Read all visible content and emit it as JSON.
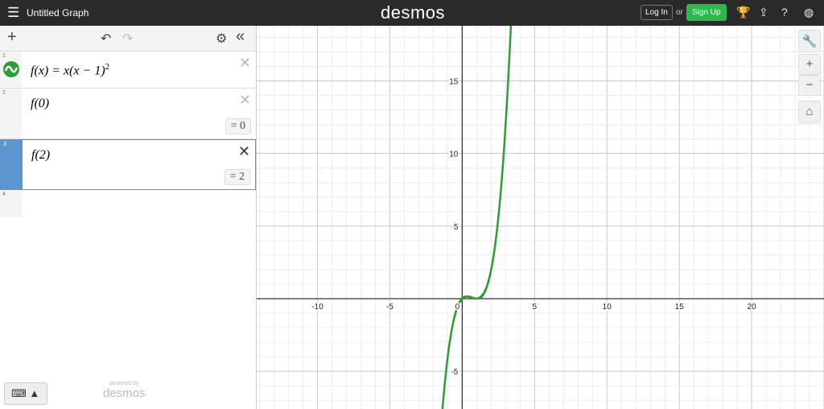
{
  "header": {
    "menu_icon": "hamburger-icon",
    "title": "Untitled Graph",
    "logo": "desmos",
    "login": "Log In",
    "or": "or",
    "signup": "Sign Up",
    "signup_color": "#2db84b",
    "icons": [
      "trophy-icon",
      "share-icon",
      "help-icon",
      "globe-icon"
    ]
  },
  "toolbar": {
    "add": "+",
    "undo": "↶",
    "redo": "↷",
    "settings": "⚙",
    "collapse": "«"
  },
  "expressions": [
    {
      "index": "1",
      "latex": "f(x) = x(x − 1)",
      "sup": "2",
      "color": "#2f9c3a"
    },
    {
      "index": "2",
      "latex": "f(0)",
      "result": "= 0"
    },
    {
      "index": "3",
      "latex": "f(2)",
      "result": "= 2"
    },
    {
      "index": "4"
    }
  ],
  "keyboard": {
    "icon": "⌨ ▲"
  },
  "powered": {
    "line1": "powered by",
    "line2": "desmos"
  },
  "controls": {
    "wrench": "🔧",
    "zoom_in": "+",
    "zoom_out": "−",
    "home": "⌂"
  },
  "chart_data": {
    "type": "line",
    "function": "x*(x-1)^2",
    "color": "#2f9c3a",
    "xticks": [
      -10,
      -5,
      0,
      5,
      10,
      15,
      20
    ],
    "yticks": [
      -5,
      5,
      10,
      15
    ],
    "xlim": [
      -14.2,
      25
    ],
    "ylim": [
      -7.6,
      18.8
    ],
    "grid": true
  }
}
